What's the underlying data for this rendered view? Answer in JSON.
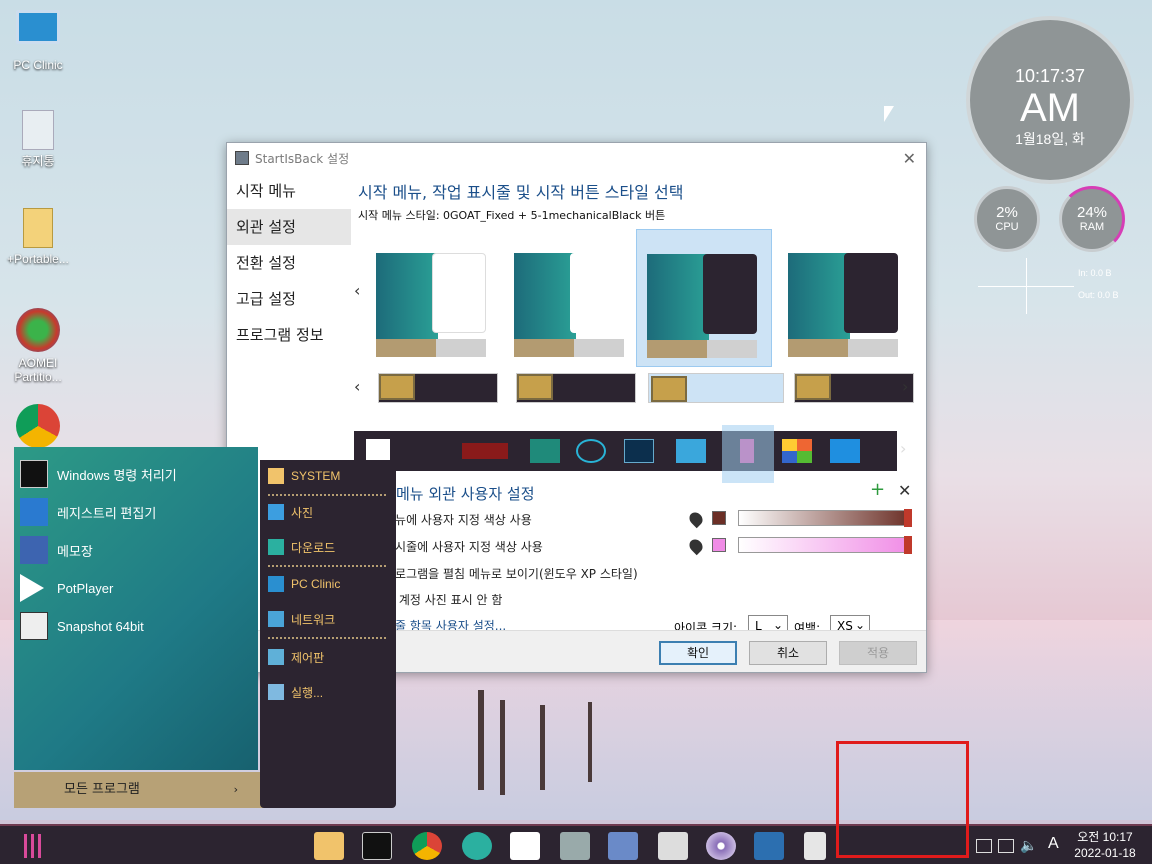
{
  "desktop": {
    "icons": [
      {
        "label": "PC Clinic"
      },
      {
        "label": "휴지통"
      },
      {
        "label": "+Portable..."
      },
      {
        "label": "AOMEI Partitio..."
      }
    ]
  },
  "clock_gadget": {
    "time": "10:17:37",
    "ampm": "AM",
    "date": "1월18일, 화",
    "cpu": {
      "value": "2%",
      "label": "CPU"
    },
    "ram": {
      "value": "24%",
      "label": "RAM"
    },
    "net_in": "In: 0.0 B",
    "net_out": "Out: 0.0 B"
  },
  "dialog": {
    "title": "StartIsBack 설정",
    "nav": [
      "시작 메뉴",
      "외관 설정",
      "전환 설정",
      "고급 설정",
      "프로그램 정보"
    ],
    "active_nav": 1,
    "heading": "시작 메뉴, 작업 표시줄 및 시작 버튼 스타일 선택",
    "style_line": "시작 메뉴 스타일:  0GOAT_Fixed + 5-1mechanicalBlack 버튼",
    "custom_title": "메뉴 외관 사용자 설정",
    "options": [
      "메뉴에 사용자 지정 색상 사용",
      "표시줄에 사용자 지정 색상 사용",
      "프로그램을 펼침 메뉴로 보이기(윈도우 XP 스타일)",
      "자 계정 사진 표시 안 함",
      "시줄 항목 사용자 설정..."
    ],
    "menu_color": "#6b2f26",
    "taskbar_color": "#f08ce6",
    "icon_size_label": "아이콘 크기:",
    "icon_size_value": "L",
    "margin_label": "여백:",
    "margin_value": "XS",
    "buttons": {
      "ok": "확인",
      "cancel": "취소",
      "apply": "적용"
    }
  },
  "start_menu": {
    "programs": [
      "Windows 명령 처리기",
      "레지스트리 편집기",
      "메모장",
      "PotPlayer",
      "Snapshot 64bit"
    ],
    "all_programs": "모든 프로그램",
    "right_items": [
      "SYSTEM",
      "사진",
      "다운로드",
      "PC Clinic",
      "네트워크",
      "제어판",
      "실행..."
    ]
  },
  "taskbar": {
    "clock_ampm_time": "오전 10:17",
    "clock_date": "2022-01-18",
    "ime": "A"
  }
}
